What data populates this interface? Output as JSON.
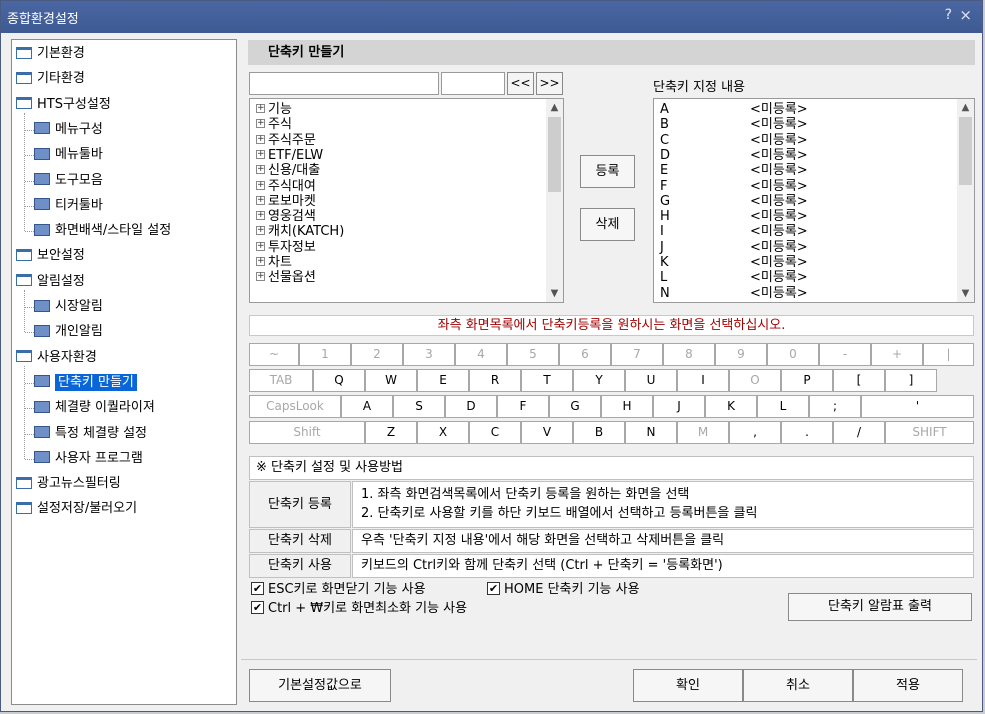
{
  "window": {
    "title": "종합환경설정",
    "help": "?",
    "close": "×"
  },
  "tree": [
    {
      "label": "기본환경",
      "icon": "folder-icon",
      "level": 0
    },
    {
      "label": "기타환경",
      "icon": "folder-icon",
      "level": 0
    },
    {
      "label": "HTS구성설정",
      "icon": "folder-icon",
      "level": 0
    },
    {
      "label": "메뉴구성",
      "icon": "page-icon",
      "level": 1
    },
    {
      "label": "메뉴툴바",
      "icon": "page-icon",
      "level": 1
    },
    {
      "label": "도구모음",
      "icon": "page-icon",
      "level": 1
    },
    {
      "label": "티커툴바",
      "icon": "page-icon",
      "level": 1
    },
    {
      "label": "화면배색/스타일 설정",
      "icon": "page-icon",
      "level": 1
    },
    {
      "label": "보안설정",
      "icon": "folder-icon",
      "level": 0
    },
    {
      "label": "알림설정",
      "icon": "folder-icon",
      "level": 0
    },
    {
      "label": "시장알림",
      "icon": "page-icon",
      "level": 1
    },
    {
      "label": "개인알림",
      "icon": "page-icon",
      "level": 1
    },
    {
      "label": "사용자환경",
      "icon": "folder-icon",
      "level": 0
    },
    {
      "label": "단축키 만들기",
      "icon": "page-icon",
      "level": 1,
      "selected": true
    },
    {
      "label": "체결량 이퀄라이져",
      "icon": "page-icon",
      "level": 1
    },
    {
      "label": "특정 체결량 설정",
      "icon": "page-icon",
      "level": 1
    },
    {
      "label": "사용자 프로그램",
      "icon": "page-icon",
      "level": 1
    },
    {
      "label": "광고뉴스필터링",
      "icon": "folder-icon",
      "level": 0
    },
    {
      "label": "설정저장/불러오기",
      "icon": "folder-icon",
      "level": 0
    }
  ],
  "panel": {
    "title": "단축키 만들기",
    "search_value": "",
    "prev_label": "<<",
    "next_label": ">>",
    "screen_list": [
      "기능",
      "주식",
      "주식주문",
      "ETF/ELW",
      "신용/대출",
      "주식대여",
      "로보마켓",
      "영웅검색",
      "캐치(KATCH)",
      "투자정보",
      "차트",
      "선물옵션"
    ],
    "register_label": "등록",
    "delete_label": "삭제",
    "mapping_title": "단축키 지정 내용",
    "mappings": [
      {
        "key": "A",
        "value": "<미등록>"
      },
      {
        "key": "B",
        "value": "<미등록>"
      },
      {
        "key": "C",
        "value": "<미등록>"
      },
      {
        "key": "D",
        "value": "<미등록>"
      },
      {
        "key": "E",
        "value": "<미등록>"
      },
      {
        "key": "F",
        "value": "<미등록>"
      },
      {
        "key": "G",
        "value": "<미등록>"
      },
      {
        "key": "H",
        "value": "<미등록>"
      },
      {
        "key": "I",
        "value": "<미등록>"
      },
      {
        "key": "J",
        "value": "<미등록>"
      },
      {
        "key": "K",
        "value": "<미등록>"
      },
      {
        "key": "L",
        "value": "<미등록>"
      },
      {
        "key": "N",
        "value": "<미등록>"
      }
    ],
    "info_message": "좌측 화면목록에서 단축키등록을 원하시는 화면을 선택하십시오."
  },
  "keyboard": {
    "row1": [
      {
        "label": "~",
        "enabled": false
      },
      {
        "label": "1",
        "enabled": false
      },
      {
        "label": "2",
        "enabled": false
      },
      {
        "label": "3",
        "enabled": false
      },
      {
        "label": "4",
        "enabled": false
      },
      {
        "label": "5",
        "enabled": false
      },
      {
        "label": "6",
        "enabled": false
      },
      {
        "label": "7",
        "enabled": false
      },
      {
        "label": "8",
        "enabled": false
      },
      {
        "label": "9",
        "enabled": false
      },
      {
        "label": "0",
        "enabled": false
      },
      {
        "label": "-",
        "enabled": false
      },
      {
        "label": "+",
        "enabled": false
      },
      {
        "label": "|",
        "enabled": false
      }
    ],
    "row2": [
      {
        "label": "TAB",
        "enabled": false
      },
      {
        "label": "Q",
        "enabled": true
      },
      {
        "label": "W",
        "enabled": true
      },
      {
        "label": "E",
        "enabled": true
      },
      {
        "label": "R",
        "enabled": true
      },
      {
        "label": "T",
        "enabled": true
      },
      {
        "label": "Y",
        "enabled": true
      },
      {
        "label": "U",
        "enabled": true
      },
      {
        "label": "I",
        "enabled": true
      },
      {
        "label": "O",
        "enabled": false
      },
      {
        "label": "P",
        "enabled": true
      },
      {
        "label": "[",
        "enabled": true
      },
      {
        "label": "]",
        "enabled": true
      }
    ],
    "row3": [
      {
        "label": "CapsLook",
        "enabled": false
      },
      {
        "label": "A",
        "enabled": true
      },
      {
        "label": "S",
        "enabled": true
      },
      {
        "label": "D",
        "enabled": true
      },
      {
        "label": "F",
        "enabled": true
      },
      {
        "label": "G",
        "enabled": true
      },
      {
        "label": "H",
        "enabled": true
      },
      {
        "label": "J",
        "enabled": true
      },
      {
        "label": "K",
        "enabled": true
      },
      {
        "label": "L",
        "enabled": true
      },
      {
        "label": ";",
        "enabled": true
      },
      {
        "label": "'",
        "enabled": true
      }
    ],
    "row4": [
      {
        "label": "Shift",
        "enabled": false
      },
      {
        "label": "Z",
        "enabled": true
      },
      {
        "label": "X",
        "enabled": true
      },
      {
        "label": "C",
        "enabled": true
      },
      {
        "label": "V",
        "enabled": true
      },
      {
        "label": "B",
        "enabled": true
      },
      {
        "label": "N",
        "enabled": true
      },
      {
        "label": "M",
        "enabled": false
      },
      {
        "label": ",",
        "enabled": true
      },
      {
        "label": ".",
        "enabled": true
      },
      {
        "label": "/",
        "enabled": true
      },
      {
        "label": "SHIFT",
        "enabled": false
      }
    ]
  },
  "help": {
    "header": "※ 단축키 설정 및 사용방법",
    "register_label": "단축키 등록",
    "register_line1": "1. 좌측 화면검색목록에서 단축키 등록을 원하는 화면을 선택",
    "register_line2": "2. 단축키로 사용할 키를 하단 키보드 배열에서 선택하고 등록버튼을 클릭",
    "delete_label": "단축키 삭제",
    "delete_text": "우측 '단축키 지정 내용'에서 해당 화면을 선택하고 삭제버튼을 클릭",
    "use_label": "단축키 사용",
    "use_text": "키보드의 Ctrl키와 함께 단축키 선택 (Ctrl + 단축키 = '등록화면')"
  },
  "options": {
    "esc_close": {
      "label": "ESC키로 화면닫기 기능 사용",
      "checked": true
    },
    "home_key": {
      "label": "HOME 단축키 기능 사용",
      "checked": true
    },
    "ctrl_won_minimize": {
      "label": "Ctrl + ₩키로 화면최소화 기능 사용",
      "checked": true
    },
    "print_label": "단축키 알람표 출력"
  },
  "footer": {
    "default_label": "기본설정값으로",
    "ok_label": "확인",
    "cancel_label": "취소",
    "apply_label": "적용"
  }
}
